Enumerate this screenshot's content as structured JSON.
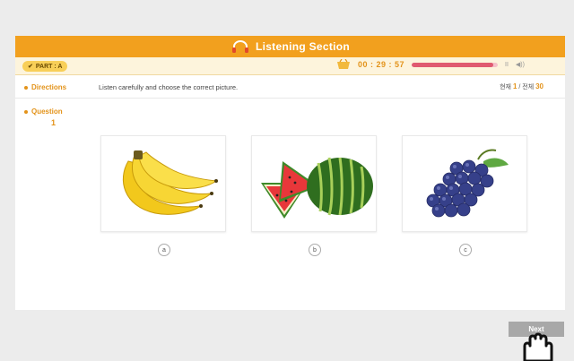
{
  "header": {
    "title": "Listening Section",
    "icon": "headset-icon"
  },
  "toolbar": {
    "part_label": "PART : A",
    "timer": "00 : 29 : 57",
    "progress": 0.95,
    "pause_label": "II",
    "volume_label": "◀))"
  },
  "directions": {
    "label": "Directions",
    "text": "Listen carefully and choose the correct picture.",
    "count_prefix": "현재",
    "current": "1",
    "separator": "/ 전체",
    "total": "30"
  },
  "question": {
    "label": "Question",
    "number": "1"
  },
  "choices": [
    {
      "letter": "a",
      "image": "banana"
    },
    {
      "letter": "b",
      "image": "watermelon"
    },
    {
      "letter": "c",
      "image": "grapes"
    }
  ],
  "colors": {
    "accent": "#f2a01e",
    "progress": "#e05a70",
    "next_button": "#a8a8a8"
  },
  "footer": {
    "next_label": "Next"
  }
}
